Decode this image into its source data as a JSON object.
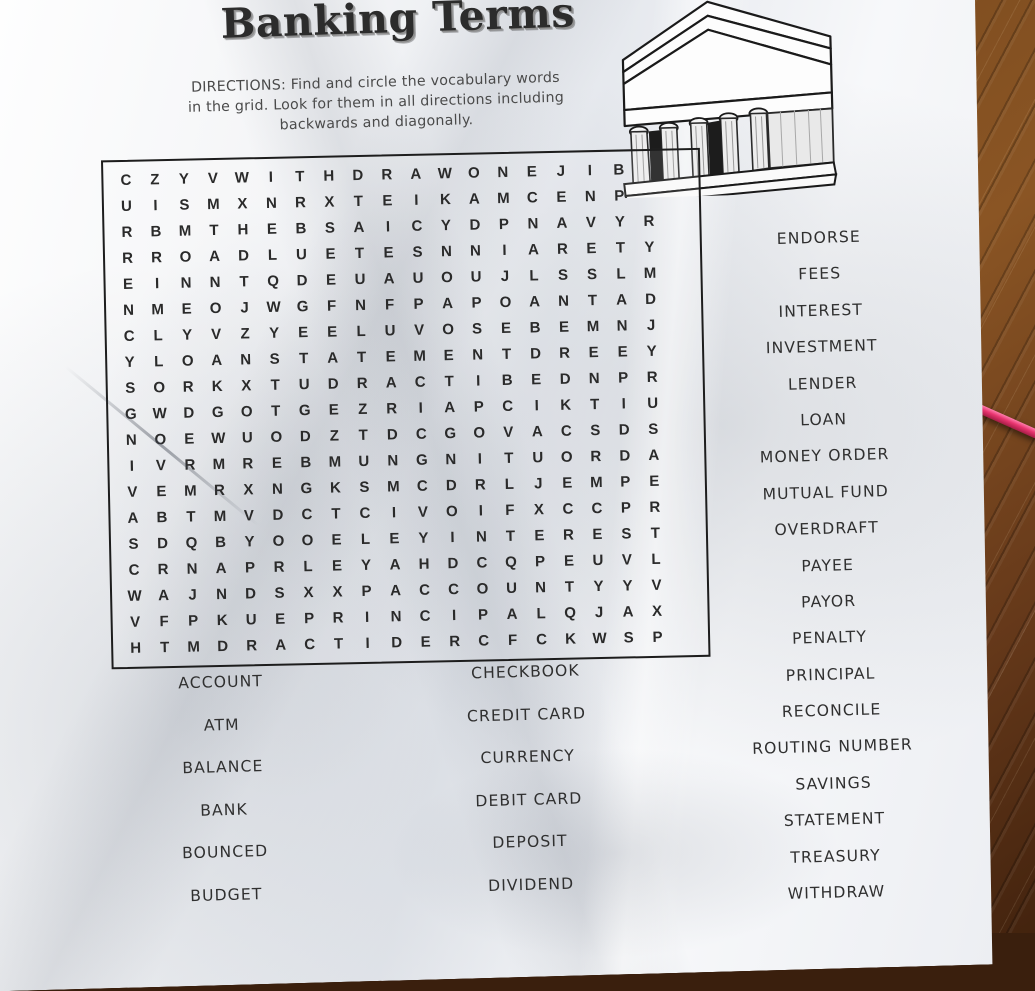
{
  "page": {
    "title": "Banking Terms",
    "directions": "DIRECTIONS:  Find and circle the vocabulary words in the grid.  Look for them in all directions including backwards and diagonally."
  },
  "illustration": {
    "name": "bank-building-illustration",
    "description": "Classical bank building with pediment and columns"
  },
  "colors": {
    "paper": "#f2f4f7",
    "ink": "#2a2a2a",
    "desk": "#7a4a1e",
    "pen": "#e8346f"
  },
  "grid": {
    "rows": 20,
    "cols": 20,
    "letters": [
      "CZYVWITHDRAWONEJIB?",
      "UISMXNRXTEIKAMCENP?",
      "RBMTHEBSAICYDPNAVYR",
      "RROADLUETESNNIARETY",
      "EINNTQDEUAUOUJLSSLM",
      "NMEOJWGFNFPAPOANTAD",
      "CLYVZYEELUVOSEBEMNJ",
      "YLOANSTATEMENTDREEY",
      "SORKXTUDRACTIBEDNPR",
      "GWDGOTGEZRIAPCIKTIU",
      "NOEWUODZTDCGOVACSDS",
      "IVRMREBMUNGNITUORDA",
      "VEMRXNGKSMCDRLJEMPE",
      "ABTMVDCTCIVOIFXCCPR",
      "SDQBYOOELEYINTEREST",
      "CRNAPRLEYAHDCQPEUVL",
      "WAJNDSXXPACCOUNTYYV",
      "VFPKUEPRINCIPALQJAX",
      "HTMDRACTIDERCFCKWSP"
    ],
    "rows_data": [
      [
        "C",
        "Z",
        "Y",
        "V",
        "W",
        "I",
        "T",
        "H",
        "D",
        "R",
        "A",
        "W",
        "O",
        "N",
        "E",
        "J",
        "I",
        "B",
        "",
        ""
      ],
      [
        "U",
        "I",
        "S",
        "M",
        "X",
        "N",
        "R",
        "X",
        "T",
        "E",
        "I",
        "K",
        "A",
        "M",
        "C",
        "E",
        "N",
        "P",
        "",
        ""
      ],
      [
        "R",
        "B",
        "M",
        "T",
        "H",
        "E",
        "B",
        "S",
        "A",
        "I",
        "C",
        "Y",
        "D",
        "P",
        "N",
        "A",
        "V",
        "Y",
        "R",
        ""
      ],
      [
        "R",
        "R",
        "O",
        "A",
        "D",
        "L",
        "U",
        "E",
        "T",
        "E",
        "S",
        "N",
        "N",
        "I",
        "A",
        "R",
        "E",
        "T",
        "Y",
        ""
      ],
      [
        "E",
        "I",
        "N",
        "N",
        "T",
        "Q",
        "D",
        "E",
        "U",
        "A",
        "U",
        "O",
        "U",
        "J",
        "L",
        "S",
        "S",
        "L",
        "M",
        ""
      ],
      [
        "N",
        "M",
        "E",
        "O",
        "J",
        "W",
        "G",
        "F",
        "N",
        "F",
        "P",
        "A",
        "P",
        "O",
        "A",
        "N",
        "T",
        "A",
        "D",
        ""
      ],
      [
        "C",
        "L",
        "Y",
        "V",
        "Z",
        "Y",
        "E",
        "E",
        "L",
        "U",
        "V",
        "O",
        "S",
        "E",
        "B",
        "E",
        "M",
        "N",
        "J",
        ""
      ],
      [
        "Y",
        "L",
        "O",
        "A",
        "N",
        "S",
        "T",
        "A",
        "T",
        "E",
        "M",
        "E",
        "N",
        "T",
        "D",
        "R",
        "E",
        "E",
        "Y",
        ""
      ],
      [
        "S",
        "O",
        "R",
        "K",
        "X",
        "T",
        "U",
        "D",
        "R",
        "A",
        "C",
        "T",
        "I",
        "B",
        "E",
        "D",
        "N",
        "P",
        "R",
        ""
      ],
      [
        "G",
        "W",
        "D",
        "G",
        "O",
        "T",
        "G",
        "E",
        "Z",
        "R",
        "I",
        "A",
        "P",
        "C",
        "I",
        "K",
        "T",
        "I",
        "U",
        ""
      ],
      [
        "N",
        "O",
        "E",
        "W",
        "U",
        "O",
        "D",
        "Z",
        "T",
        "D",
        "C",
        "G",
        "O",
        "V",
        "A",
        "C",
        "S",
        "D",
        "S",
        ""
      ],
      [
        "I",
        "V",
        "R",
        "M",
        "R",
        "E",
        "B",
        "M",
        "U",
        "N",
        "G",
        "N",
        "I",
        "T",
        "U",
        "O",
        "R",
        "D",
        "A",
        ""
      ],
      [
        "V",
        "E",
        "M",
        "R",
        "X",
        "N",
        "G",
        "K",
        "S",
        "M",
        "C",
        "D",
        "R",
        "L",
        "J",
        "E",
        "M",
        "P",
        "E",
        ""
      ],
      [
        "A",
        "B",
        "T",
        "M",
        "V",
        "D",
        "C",
        "T",
        "C",
        "I",
        "V",
        "O",
        "I",
        "F",
        "X",
        "C",
        "C",
        "P",
        "R",
        ""
      ],
      [
        "S",
        "D",
        "Q",
        "B",
        "Y",
        "O",
        "O",
        "E",
        "L",
        "E",
        "Y",
        "I",
        "N",
        "T",
        "E",
        "R",
        "E",
        "S",
        "T",
        ""
      ],
      [
        "C",
        "R",
        "N",
        "A",
        "P",
        "R",
        "L",
        "E",
        "Y",
        "A",
        "H",
        "D",
        "C",
        "Q",
        "P",
        "E",
        "U",
        "V",
        "L",
        ""
      ],
      [
        "W",
        "A",
        "J",
        "N",
        "D",
        "S",
        "X",
        "X",
        "P",
        "A",
        "C",
        "C",
        "O",
        "U",
        "N",
        "T",
        "Y",
        "Y",
        "V",
        ""
      ],
      [
        "V",
        "F",
        "P",
        "K",
        "U",
        "E",
        "P",
        "R",
        "I",
        "N",
        "C",
        "I",
        "P",
        "A",
        "L",
        "Q",
        "J",
        "A",
        "X",
        ""
      ],
      [
        "H",
        "T",
        "M",
        "D",
        "R",
        "A",
        "C",
        "T",
        "I",
        "D",
        "E",
        "R",
        "C",
        "F",
        "C",
        "K",
        "W",
        "S",
        "P",
        ""
      ]
    ]
  },
  "wordlist": {
    "left_column": [
      "ACCOUNT",
      "ATM",
      "BALANCE",
      "BANK",
      "BOUNCED",
      "BUDGET"
    ],
    "middle_column": [
      "CHECKBOOK",
      "CREDIT CARD",
      "CURRENCY",
      "DEBIT CARD",
      "DEPOSIT",
      "DIVIDEND"
    ],
    "right_column": [
      "ENDORSE",
      "FEES",
      "INTEREST",
      "INVESTMENT",
      "LENDER",
      "LOAN",
      "MONEY ORDER",
      "MUTUAL FUND",
      "OVERDRAFT",
      "PAYEE",
      "PAYOR",
      "PENALTY",
      "PRINCIPAL",
      "RECONCILE",
      "ROUTING NUMBER",
      "SAVINGS",
      "STATEMENT",
      "TREASURY",
      "WITHDRAW"
    ]
  }
}
